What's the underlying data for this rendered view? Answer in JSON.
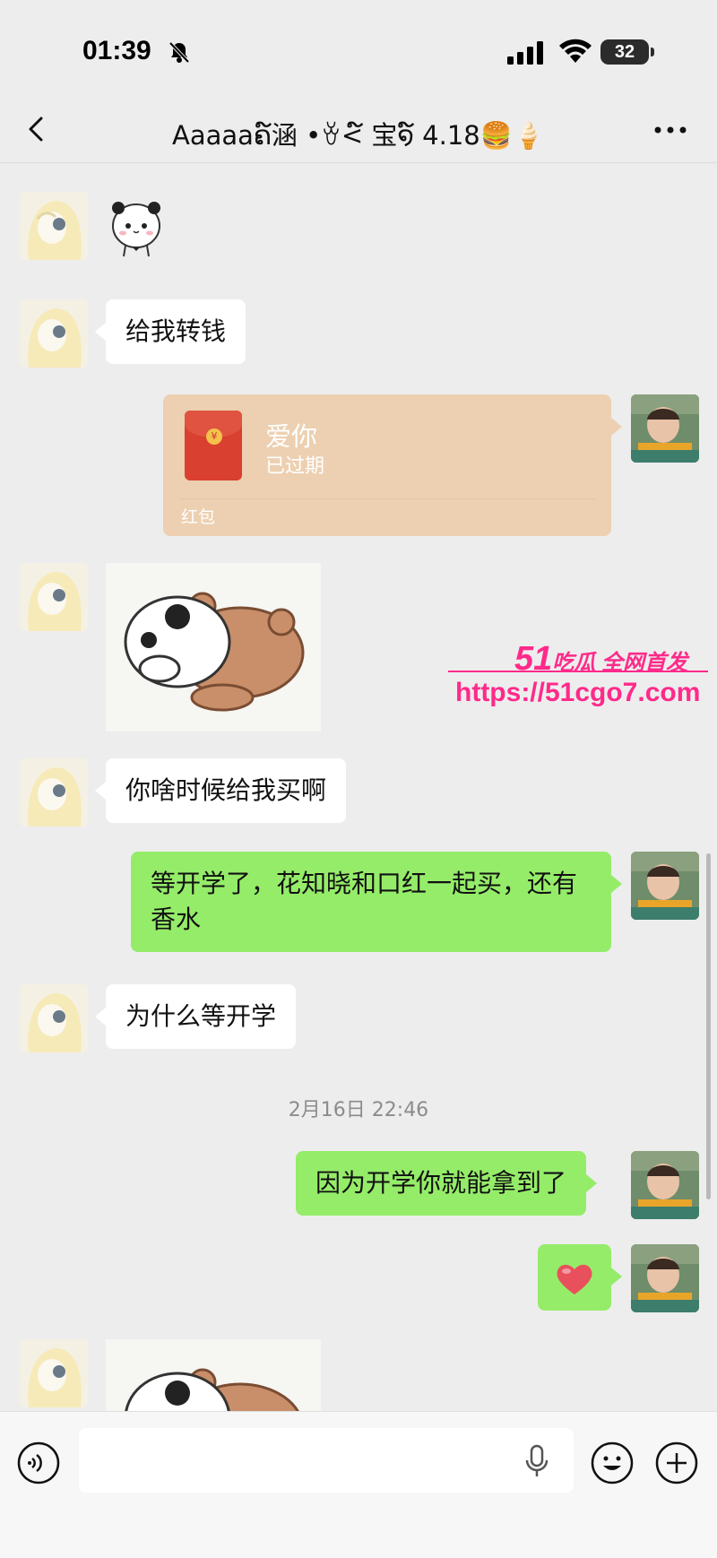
{
  "status_bar": {
    "time": "01:39",
    "battery": "32",
    "icons": [
      "bell-off-icon",
      "signal-icon",
      "wifi-icon",
      "battery-icon"
    ]
  },
  "nav": {
    "title": "Aaaaaຄ໌涵 •ꈊ<໌ 宝໑໌ 4.18🍔🍦",
    "icons": [
      "back-icon",
      "more-icon"
    ]
  },
  "messages": [
    {
      "side": "in",
      "type": "sticker",
      "sticker": "panda"
    },
    {
      "side": "in",
      "type": "text",
      "text": "给我转钱"
    },
    {
      "side": "out",
      "type": "red_packet",
      "title": "爱你",
      "status": "已过期",
      "label": "红包"
    },
    {
      "side": "in",
      "type": "sticker",
      "sticker": "panda-hugging-bear"
    },
    {
      "side": "in",
      "type": "text",
      "text": "你啥时候给我买啊"
    },
    {
      "side": "out",
      "type": "text",
      "text": "等开学了，花知晓和口红一起买，还有香水"
    },
    {
      "side": "in",
      "type": "text",
      "text": "为什么等开学"
    },
    {
      "type": "timestamp",
      "text": "2月16日 22:46"
    },
    {
      "side": "out",
      "type": "text",
      "text": "因为开学你就能拿到了"
    },
    {
      "side": "out",
      "type": "emoji",
      "emoji": "heart"
    },
    {
      "side": "in",
      "type": "sticker",
      "sticker": "panda-hugging-bear"
    }
  ],
  "watermark": {
    "brand_number": "51",
    "brand_text": "吃瓜 全网首发",
    "url": "https://51cgo7.com",
    "color": "#ff2a8a"
  },
  "input_bar": {
    "value": "",
    "icons": [
      "voice-icon",
      "mic-icon",
      "emoji-icon",
      "plus-icon"
    ]
  },
  "colors": {
    "background": "#ededed",
    "outgoing_bubble": "#95ec69",
    "incoming_bubble": "#ffffff",
    "red_packet_expired": "#ecd0b1"
  }
}
